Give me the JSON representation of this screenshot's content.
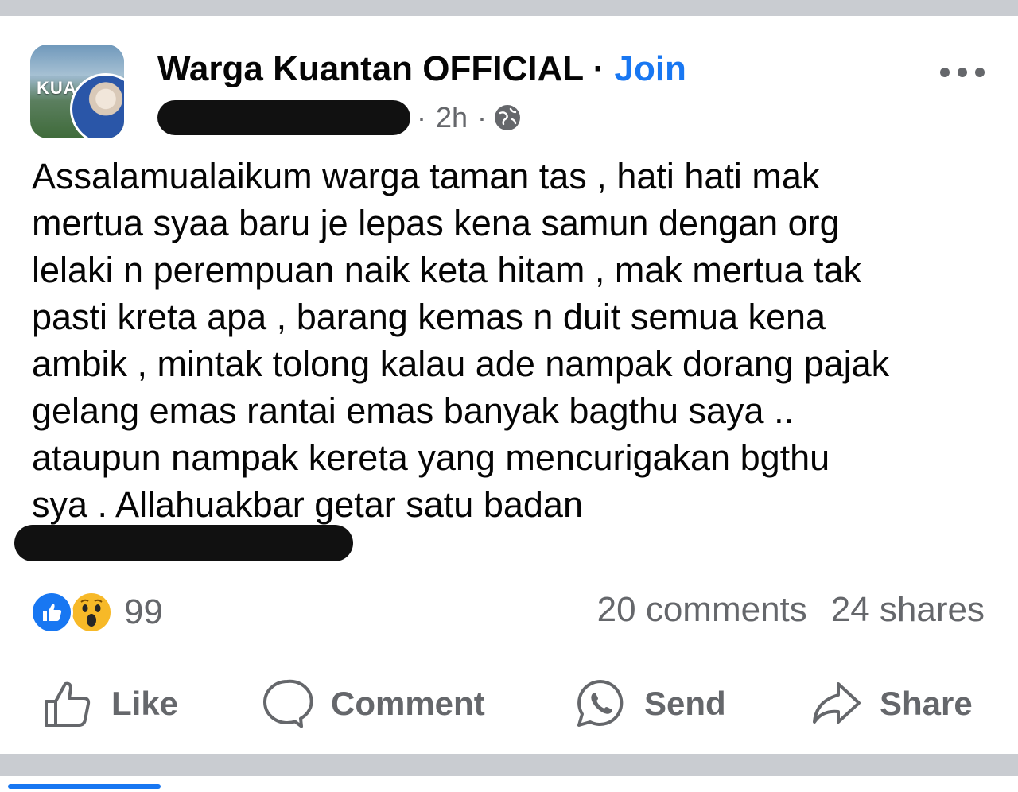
{
  "post": {
    "group_name": "Warga Kuantan OFFICIAL",
    "separator": "·",
    "join_label": "Join",
    "time": "2h",
    "meta_separator": "·",
    "avatar_text": "KUA",
    "body_lines": [
      "Assalamualaikum warga taman tas , hati hati mak",
      "mertua syaa baru je lepas kena samun dengan org",
      "lelaki n perempuan naik keta hitam , mak mertua tak",
      "pasti kreta apa , barang kemas n duit semua kena",
      "ambik , mintak tolong kalau ade nampak dorang pajak",
      "gelang emas rantai emas banyak bagthu saya ..",
      "ataupun nampak kereta yang mencurigakan bgthu",
      "sya . Allahuakbar getar satu badan"
    ]
  },
  "engagement": {
    "reaction_count": "99",
    "comments": "20 comments",
    "shares": "24 shares"
  },
  "actions": {
    "like": "Like",
    "comment": "Comment",
    "send": "Send",
    "share": "Share"
  },
  "icons": [
    "more-icon",
    "globe-icon",
    "like-reaction-icon",
    "wow-reaction-icon",
    "thumbs-up-icon",
    "comment-bubble-icon",
    "whatsapp-icon",
    "share-arrow-icon"
  ],
  "colors": {
    "accent": "#1877f2",
    "secondary_text": "#65676b",
    "text": "#050505",
    "divider": "#c9ccd1"
  }
}
